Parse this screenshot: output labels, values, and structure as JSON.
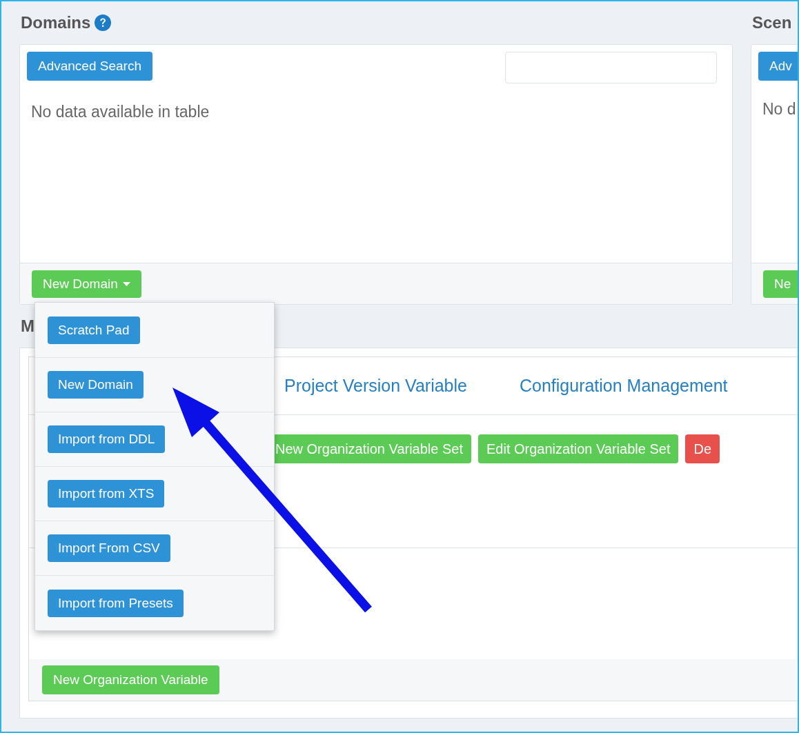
{
  "domains_panel": {
    "title": "Domains",
    "advanced_search": "Advanced Search",
    "empty_message": "No data available in table",
    "new_button": "New Domain"
  },
  "scenario_panel": {
    "title": "Scen",
    "button": "Adv",
    "empty_message": "No d",
    "new_button": "Ne"
  },
  "dropdown": {
    "items": [
      "Scratch Pad",
      "New Domain",
      "Import from DDL",
      "Import from XTS",
      "Import From CSV",
      "Import from Presets"
    ]
  },
  "section": {
    "title": "M",
    "tabs": [
      "Project Version Variable",
      "Configuration Management"
    ],
    "actions": [
      {
        "label": "New Organization Variable Set",
        "kind": "success"
      },
      {
        "label": "Edit Organization Variable Set",
        "kind": "success"
      },
      {
        "label": "De",
        "kind": "danger"
      }
    ],
    "footer_button": "New Organization Variable"
  }
}
